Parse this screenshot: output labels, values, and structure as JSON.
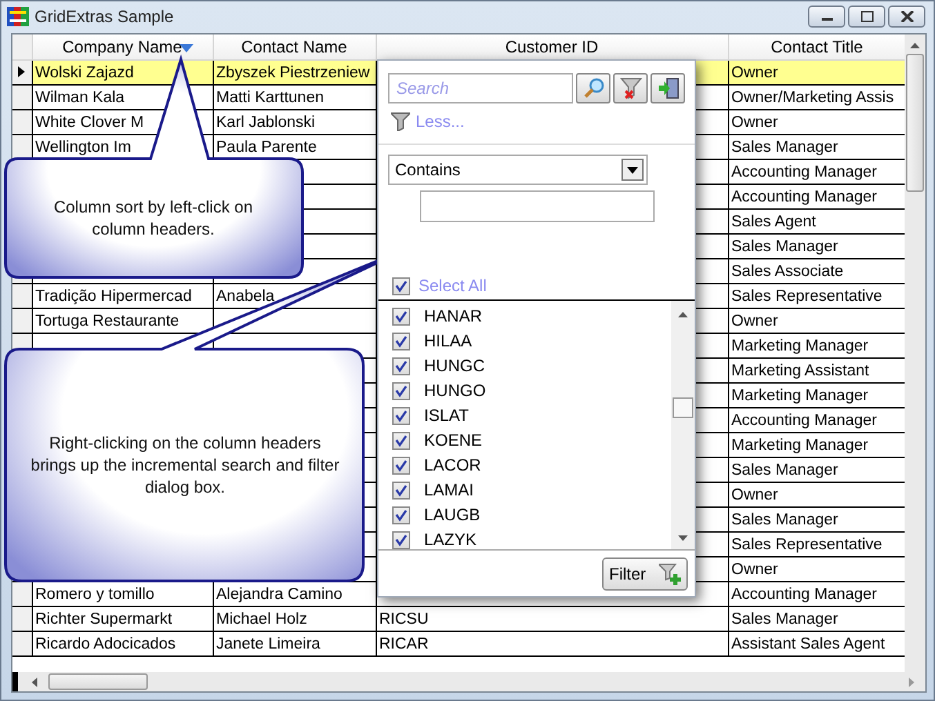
{
  "window": {
    "title": "GridExtras Sample"
  },
  "grid": {
    "columns": [
      {
        "label": "Company Name",
        "sorted": true
      },
      {
        "label": "Contact Name",
        "sorted": false
      },
      {
        "label": "Customer ID",
        "sorted": false
      },
      {
        "label": "Contact Title",
        "sorted": false
      }
    ],
    "rows": [
      {
        "selected": true,
        "company": "Wolski  Zajazd",
        "contact": "Zbyszek Piestrzeniew",
        "title": "Owner"
      },
      {
        "selected": false,
        "company": "Wilman Kala",
        "contact": "Matti Karttunen",
        "title": "Owner/Marketing Assis"
      },
      {
        "selected": false,
        "company": "White Clover M",
        "contact": "Karl Jablonski",
        "title": "Owner"
      },
      {
        "selected": false,
        "company": "Wellington Im",
        "contact": "Paula Parente",
        "title": "Sales Manager"
      },
      {
        "selected": false,
        "title": "Accounting Manager"
      },
      {
        "selected": false,
        "title": "Accounting Manager"
      },
      {
        "selected": false,
        "title": "Sales Agent"
      },
      {
        "selected": false,
        "title": "Sales Manager"
      },
      {
        "selected": false,
        "title": "Sales Associate"
      },
      {
        "selected": false,
        "company": "Tradição Hipermercad",
        "contact": "Anabela",
        "title": "Sales Representative"
      },
      {
        "selected": false,
        "company": "Tortuga Restaurante",
        "title": "Owner"
      },
      {
        "selected": false,
        "title": "Marketing Manager"
      },
      {
        "selected": false,
        "title": "Marketing Assistant"
      },
      {
        "selected": false,
        "title": "Marketing Manager"
      },
      {
        "selected": false,
        "title": "Accounting Manager"
      },
      {
        "selected": false,
        "title": "Marketing Manager"
      },
      {
        "selected": false,
        "title": "Sales Manager"
      },
      {
        "selected": false,
        "title": "Owner"
      },
      {
        "selected": false,
        "title": "Sales Manager"
      },
      {
        "selected": false,
        "title": "Sales Representative"
      },
      {
        "selected": false,
        "title": "Owner"
      },
      {
        "selected": false,
        "company": "Romero y tomillo",
        "contact": "Alejandra Camino",
        "title": "Accounting Manager"
      },
      {
        "selected": false,
        "company": "Richter Supermarkt",
        "contact": "Michael Holz",
        "customer_id": "RICSU",
        "title": "Sales Manager"
      },
      {
        "selected": false,
        "company": "Ricardo Adocicados",
        "contact": "Janete Limeira",
        "customer_id": "RICAR",
        "title": "Assistant Sales Agent"
      }
    ]
  },
  "callouts": [
    {
      "text": "Column sort by left-click on column headers."
    },
    {
      "text": "Right-clicking on the column headers brings up the incremental search and filter dialog box."
    }
  ],
  "filter_popup": {
    "search": {
      "placeholder": "Search"
    },
    "less_link": "Less...",
    "operator": "Contains",
    "select_all": {
      "label": "Select All",
      "checked": true
    },
    "items": [
      {
        "label": "HANAR",
        "checked": true
      },
      {
        "label": "HILAA",
        "checked": true
      },
      {
        "label": "HUNGC",
        "checked": true
      },
      {
        "label": "HUNGO",
        "checked": true
      },
      {
        "label": "ISLAT",
        "checked": true
      },
      {
        "label": "KOENE",
        "checked": true
      },
      {
        "label": "LACOR",
        "checked": true
      },
      {
        "label": "LAMAI",
        "checked": true
      },
      {
        "label": "LAUGB",
        "checked": true
      },
      {
        "label": "LAZYK",
        "checked": true
      }
    ],
    "filter_button": "Filter"
  }
}
